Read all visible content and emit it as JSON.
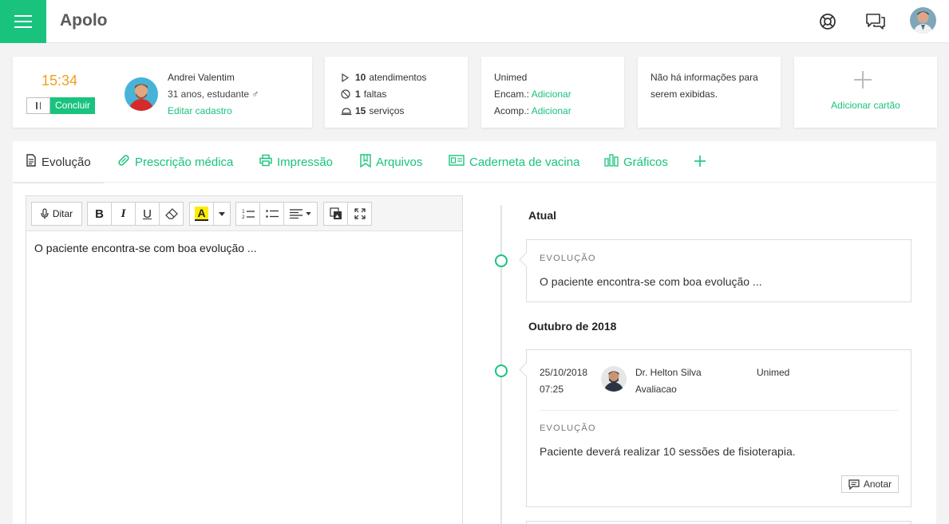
{
  "app": {
    "title": "Apolo"
  },
  "header_icons": [
    "lifebuoy-icon",
    "chat-icon",
    "user-avatar"
  ],
  "timer": {
    "time": "15:34",
    "conclude_label": "Concluir"
  },
  "patient": {
    "name": "Andrei Valentim",
    "info": "31 anos, estudante ♂",
    "edit_label": "Editar cadastro"
  },
  "stats": {
    "attendances_count": "10",
    "attendances_label": "atendimentos",
    "absences_count": "1",
    "absences_label": "faltas",
    "services_count": "15",
    "services_label": "serviços"
  },
  "insurance": {
    "name": "Unimed",
    "encam_label": "Encam.:",
    "acomp_label": "Acomp.:",
    "add_label": "Adicionar"
  },
  "info_card": {
    "line1": "Não há informações para",
    "line2": "serem exibidas."
  },
  "add_card": {
    "label": "Adicionar cartão"
  },
  "tabs": [
    {
      "label": "Evolução",
      "icon": "document-icon",
      "active": true
    },
    {
      "label": "Prescrição médica",
      "icon": "pill-icon"
    },
    {
      "label": "Impressão",
      "icon": "printer-icon"
    },
    {
      "label": "Arquivos",
      "icon": "folder-icon"
    },
    {
      "label": "Caderneta de vacina",
      "icon": "vaccine-card-icon"
    },
    {
      "label": "Gráficos",
      "icon": "chart-icon"
    }
  ],
  "editor": {
    "dictate_label": "Ditar",
    "content": "O paciente encontra-se com boa evolução ...",
    "highlight_color": "#ffeb00"
  },
  "timeline": {
    "current_heading": "Atual",
    "current_entry": {
      "label": "EVOLUÇÃO",
      "text": "O paciente encontra-se com boa evolução ..."
    },
    "month_heading": "Outubro de 2018",
    "entry": {
      "date": "25/10/2018",
      "time": "07:25",
      "doctor": "Dr. Helton Silva",
      "type": "Avaliacao",
      "insurance": "Unimed",
      "label": "EVOLUÇÃO",
      "text": "Paciente deverá realizar 10 sessões de fisioterapia.",
      "annotate_label": "Anotar"
    }
  },
  "colors": {
    "accent": "#19c37d",
    "timer": "#f0a020"
  }
}
